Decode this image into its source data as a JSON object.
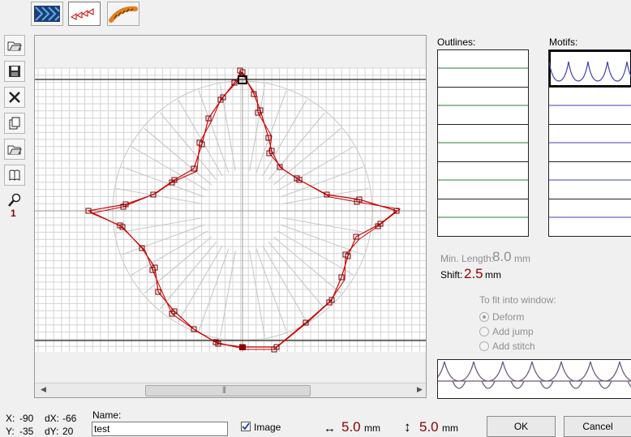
{
  "toolbar": {
    "tabs": [
      {
        "icon": "pattern-fill-icon"
      },
      {
        "icon": "motif-run-icon"
      },
      {
        "icon": "rope-stitch-icon"
      }
    ]
  },
  "side_tools": [
    {
      "icon": "open-folder-icon"
    },
    {
      "icon": "save-icon"
    },
    {
      "icon": "delete-icon"
    },
    {
      "icon": "duplicate-icon"
    },
    {
      "icon": "open-folder-icon"
    },
    {
      "icon": "library-icon"
    }
  ],
  "zoom": {
    "icon": "magnifier-icon",
    "value": "1"
  },
  "outlines_label": "Outlines:",
  "motifs_label": "Motifs:",
  "min_length": {
    "label": "Min. Length:",
    "value": "8.0",
    "unit": "mm"
  },
  "shift": {
    "label": "Shift:",
    "value": "2.5",
    "unit": "mm"
  },
  "fit": {
    "title": "To fit into window:",
    "options": [
      {
        "label": "Deform",
        "selected": true
      },
      {
        "label": "Add jump",
        "selected": false
      },
      {
        "label": "Add stitch",
        "selected": false
      }
    ]
  },
  "coords": {
    "x_label": "X:",
    "x": "-90",
    "y_label": "Y:",
    "y": "-35",
    "dx_label": "dX:",
    "dx": "-66",
    "dy_label": "dY:",
    "dy": "20"
  },
  "name": {
    "label": "Name:",
    "value": "test"
  },
  "image_checkbox": {
    "label": "Image",
    "checked": true
  },
  "width": {
    "value": "5.0",
    "unit": "mm"
  },
  "height": {
    "value": "5.0",
    "unit": "mm"
  },
  "buttons": {
    "ok": "OK",
    "cancel": "Cancel"
  },
  "colors": {
    "outline": "#cc0000",
    "motif": "#4040b0",
    "accent_value": "#8b0000",
    "outline_line": "#2e7d32"
  }
}
